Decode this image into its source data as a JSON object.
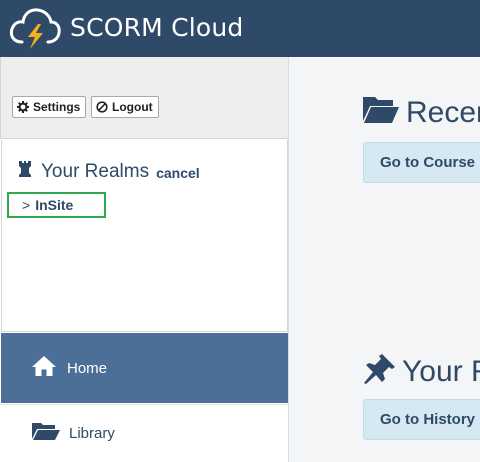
{
  "header": {
    "app_title": "SCORM Cloud",
    "logo_icon": "cloud-lightning-icon"
  },
  "settings_bar": {
    "settings_label": "Settings",
    "logout_label": "Logout"
  },
  "realms": {
    "title": "Your Realms",
    "cancel_label": "cancel",
    "items": [
      {
        "prefix": ">",
        "label": "InSite"
      }
    ]
  },
  "nav": {
    "items": [
      {
        "label": "Home",
        "icon": "home-icon",
        "active": true
      },
      {
        "label": "Library",
        "icon": "folder-open-icon",
        "active": false
      }
    ]
  },
  "main": {
    "sections": [
      {
        "title": "Recen",
        "icon": "folder-open-icon",
        "button_label": "Go to Course L"
      },
      {
        "title": "Your R",
        "icon": "pushpin-icon",
        "button_label": "Go to History"
      }
    ]
  },
  "colors": {
    "header": "#2f4a68",
    "nav_active": "#4b6f96",
    "accent_text": "#2f4a68",
    "button_bg": "#d6e9f3",
    "highlight_border": "#2fa84f"
  }
}
